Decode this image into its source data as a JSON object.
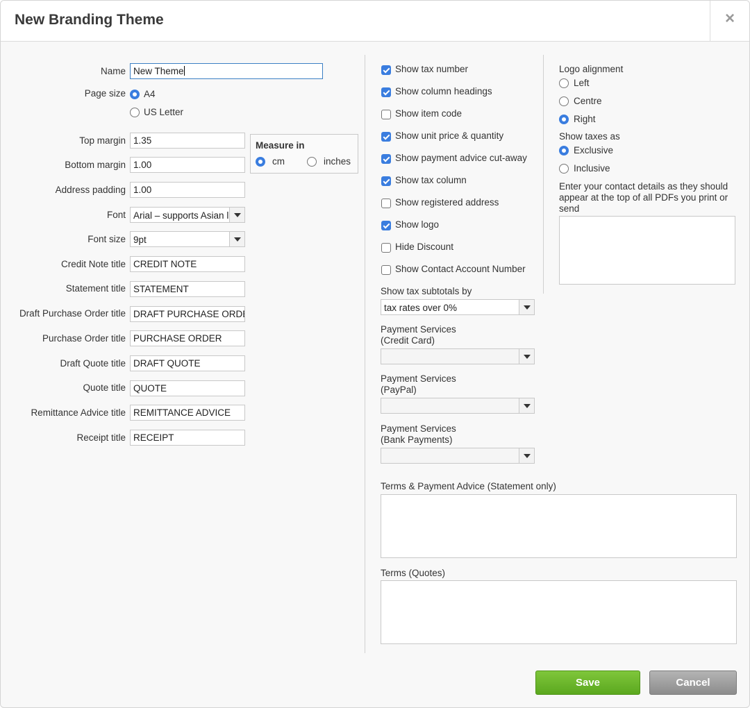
{
  "dialog": {
    "title": "New Branding Theme",
    "close_label": "×"
  },
  "left": {
    "name_label": "Name",
    "name_value": "New Theme",
    "page_size_label": "Page size",
    "page_size_options": [
      "A4",
      "US Letter"
    ],
    "page_size_selected": "A4",
    "top_margin_label": "Top margin",
    "top_margin_value": "1.35",
    "bottom_margin_label": "Bottom margin",
    "bottom_margin_value": "1.00",
    "address_padding_label": "Address padding",
    "address_padding_value": "1.00",
    "measure_in_title": "Measure in",
    "measure_options": [
      "cm",
      "inches"
    ],
    "measure_selected": "cm",
    "font_label": "Font",
    "font_value": "Arial – supports Asian l",
    "font_size_label": "Font size",
    "font_size_value": "9pt",
    "titles": [
      {
        "label": "Credit Note title",
        "value": "CREDIT NOTE"
      },
      {
        "label": "Statement title",
        "value": "STATEMENT"
      },
      {
        "label": "Draft Purchase Order title",
        "value": "DRAFT PURCHASE ORDER"
      },
      {
        "label": "Purchase Order title",
        "value": "PURCHASE ORDER"
      },
      {
        "label": "Draft Quote title",
        "value": "DRAFT QUOTE"
      },
      {
        "label": "Quote title",
        "value": "QUOTE"
      },
      {
        "label": "Remittance Advice title",
        "value": "REMITTANCE ADVICE"
      },
      {
        "label": "Receipt title",
        "value": "RECEIPT"
      }
    ]
  },
  "middle": {
    "checkboxes": [
      {
        "label": "Show tax number",
        "checked": true
      },
      {
        "label": "Show column headings",
        "checked": true
      },
      {
        "label": "Show item code",
        "checked": false
      },
      {
        "label": "Show unit price & quantity",
        "checked": true
      },
      {
        "label": "Show payment advice cut-away",
        "checked": true
      },
      {
        "label": "Show tax column",
        "checked": true
      },
      {
        "label": "Show registered address",
        "checked": false
      },
      {
        "label": "Show logo",
        "checked": true
      },
      {
        "label": "Hide Discount",
        "checked": false
      },
      {
        "label": "Show Contact Account Number",
        "checked": false
      }
    ],
    "tax_subtotals_label": "Show tax subtotals by",
    "tax_subtotals_value": "tax rates over 0%",
    "payment_credit_label_1": "Payment Services",
    "payment_credit_label_2": "(Credit Card)",
    "payment_credit_value": "",
    "payment_paypal_label_1": "Payment Services",
    "payment_paypal_label_2": "(PayPal)",
    "payment_paypal_value": "",
    "payment_bank_label_1": "Payment Services",
    "payment_bank_label_2": "(Bank Payments)",
    "payment_bank_value": "",
    "terms_statement_label": "Terms & Payment Advice (Statement only)",
    "terms_statement_value": "",
    "terms_quotes_label": "Terms (Quotes)",
    "terms_quotes_value": ""
  },
  "right": {
    "logo_alignment_label": "Logo alignment",
    "logo_alignment_options": [
      "Left",
      "Centre",
      "Right"
    ],
    "logo_alignment_selected": "Right",
    "show_taxes_label": "Show taxes as",
    "show_taxes_options": [
      "Exclusive",
      "Inclusive"
    ],
    "show_taxes_selected": "Exclusive",
    "contact_details_label_1": "Enter your contact details as they should",
    "contact_details_label_2": "appear at the top of all PDFs you print or",
    "contact_details_label_3": "send",
    "contact_details_value": ""
  },
  "footer": {
    "save_label": "Save",
    "cancel_label": "Cancel"
  },
  "colors": {
    "accent": "#3a7ddf",
    "save_button": "#6db52c",
    "cancel_button": "#a0a0a0"
  }
}
